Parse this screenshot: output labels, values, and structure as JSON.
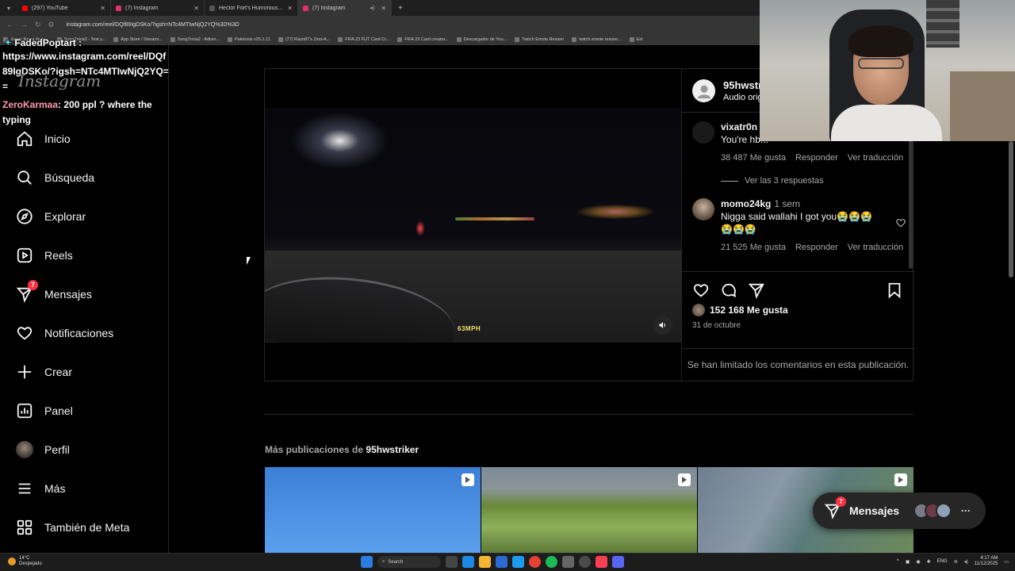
{
  "browser": {
    "tabs": [
      {
        "title": "(297) YouTube",
        "color": "#ff0000",
        "active": false
      },
      {
        "title": "(7) Instagram",
        "color": "#e1306c",
        "active": false
      },
      {
        "title": "Hector Fort's Humorous Mom...",
        "color": "#222222",
        "active": false
      },
      {
        "title": "(7) Instagram",
        "color": "#e1306c",
        "active": true
      }
    ],
    "url": "instagram.com/reel/DQf89IgDSKo/?igsh=NTc4MTIwNjQ2YQ%3D%3D",
    "bookmarks": [
      "Juego figura de to...",
      "SongTrivia2 - Test y...",
      "App Store / Streami...",
      "SongTrivia2 - Adivin...",
      "Paletools v25.1.11",
      "(77) Razo87's Zest-A...",
      "FIFA 23 FUT Card Cr...",
      "FIFA 23 Card creator...",
      "Descargador de You...",
      "Twitch Emote Resizer",
      "twitch emote resizer...",
      "Est"
    ]
  },
  "overlay": {
    "top_name": "FadedPoptart :",
    "link": "https://www.instagram.com/reel/DQf89IgDSKo/?igsh=NTc4MTIwNjQ2YQ==",
    "ghost_logo": "Instagram",
    "chat_user": "ZeroKarmaa",
    "chat_text": ": 200 ppl ? where the typing"
  },
  "sidebar": {
    "items": [
      {
        "label": "Inicio",
        "icon": "home-icon"
      },
      {
        "label": "Búsqueda",
        "icon": "search-icon"
      },
      {
        "label": "Explorar",
        "icon": "compass-icon"
      },
      {
        "label": "Reels",
        "icon": "reels-icon"
      },
      {
        "label": "Mensajes",
        "icon": "messenger-icon",
        "badge": "7"
      },
      {
        "label": "Notificaciones",
        "icon": "heart-icon"
      },
      {
        "label": "Crear",
        "icon": "plus-icon"
      },
      {
        "label": "Panel",
        "icon": "dashboard-icon"
      },
      {
        "label": "Perfil",
        "icon": "avatar"
      },
      {
        "label": "Más",
        "icon": "menu-icon"
      },
      {
        "label": "También de Meta",
        "icon": "meta-icon"
      }
    ]
  },
  "post": {
    "username": "95hwstri",
    "audio": "Audio orig",
    "video_speed": "63MPH",
    "comments": [
      {
        "user": "vixatr0n",
        "time": "",
        "text": "You're hb...",
        "likes": "38 487 Me gusta",
        "reply": "Responder",
        "translate": "Ver traducción"
      },
      {
        "user": "momo24kg",
        "time": "1 sem",
        "text": "Nigga said wallahi I got you😭😭😭😭😭😭",
        "likes": "21 525 Me gusta",
        "reply": "Responder",
        "translate": "Ver traducción"
      }
    ],
    "view_replies": "Ver las 3 respuestas",
    "like_count": "152 168 Me gusta",
    "date": "31 de octubre",
    "limited_comments": "Se han limitado los comentarios en esta publicación."
  },
  "more": {
    "prefix": "Más publicaciones de",
    "account": "95hwstriker"
  },
  "messages_pill": {
    "label": "Mensajes",
    "badge": "7"
  },
  "taskbar": {
    "temperature": "14°C",
    "weather": "Despejado",
    "search": "Search",
    "lang": "ENG",
    "time": "4:17 AM",
    "date": "11/12/2025"
  }
}
